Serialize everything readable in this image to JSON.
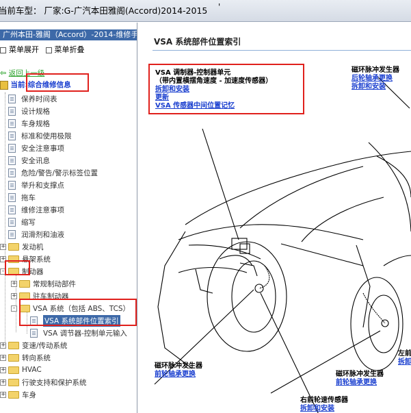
{
  "window": {
    "title": "当前车型： 厂家:G-广汽本田雅阁(Accord)2014-2015",
    "dot": "'"
  },
  "tree_header": "广州本田-雅阁（Accord）-2014-维修手",
  "menu": {
    "expand": "菜单展开",
    "collapse": "菜单折叠"
  },
  "nav": {
    "back": "返回上一级",
    "current": "当前:综合维修信息"
  },
  "tree_items": [
    {
      "label": "保养时间表",
      "type": "doc"
    },
    {
      "label": "设计规格",
      "type": "doc"
    },
    {
      "label": "车身规格",
      "type": "doc"
    },
    {
      "label": "标准和使用极限",
      "type": "doc"
    },
    {
      "label": "安全注意事项",
      "type": "doc"
    },
    {
      "label": "安全讯息",
      "type": "doc"
    },
    {
      "label": "危险/警告/警示标签位置",
      "type": "doc"
    },
    {
      "label": "举升和支撑点",
      "type": "doc"
    },
    {
      "label": "拖车",
      "type": "doc"
    },
    {
      "label": "维修注意事项",
      "type": "doc"
    },
    {
      "label": "缩写",
      "type": "doc"
    },
    {
      "label": "润滑剂和油液",
      "type": "doc"
    },
    {
      "label": "发动机",
      "type": "folder"
    },
    {
      "label": "悬架系统",
      "type": "folder"
    },
    {
      "label": "制动器",
      "type": "folder-open"
    },
    {
      "label": "常规制动部件",
      "type": "folder"
    },
    {
      "label": "驻车制动器",
      "type": "folder"
    },
    {
      "label": "VSA 系统（包括 ABS、TCS）",
      "type": "folder-open"
    },
    {
      "label": "VSA 系统部件位置索引",
      "type": "doc"
    },
    {
      "label": "VSA 调节器-控制单元输入",
      "type": "doc"
    },
    {
      "label": "变速/传动系统",
      "type": "folder"
    },
    {
      "label": "转向系统",
      "type": "folder"
    },
    {
      "label": "HVAC",
      "type": "folder"
    },
    {
      "label": "行驶支持和保护系统",
      "type": "folder"
    },
    {
      "label": "车身",
      "type": "folder"
    }
  ],
  "content": {
    "heading": "VSA 系统部件位置索引",
    "callout_main": {
      "title1": "VSA 调制器-控制器单元",
      "title2": "（带内置横摆角速度 - 加速度传感器）",
      "links": [
        "拆卸和安装",
        "更新",
        "VSA 传感器中间位置记忆"
      ]
    },
    "callout_tr": {
      "title": "磁环脉冲发生器",
      "link1": "后轮轴承更换",
      "link2": "拆卸和安装"
    },
    "callout_bl": {
      "title": "磁环脉冲发生器",
      "link": "前轮轴承更换"
    },
    "callout_bm": {
      "title": "磁环脉冲发生器",
      "link": "前轮轴承更换"
    },
    "callout_bottom": {
      "title": "右前轮速传感器",
      "link": "拆卸和安装"
    },
    "callout_br": {
      "title": "左前",
      "link": "拆卸"
    }
  }
}
